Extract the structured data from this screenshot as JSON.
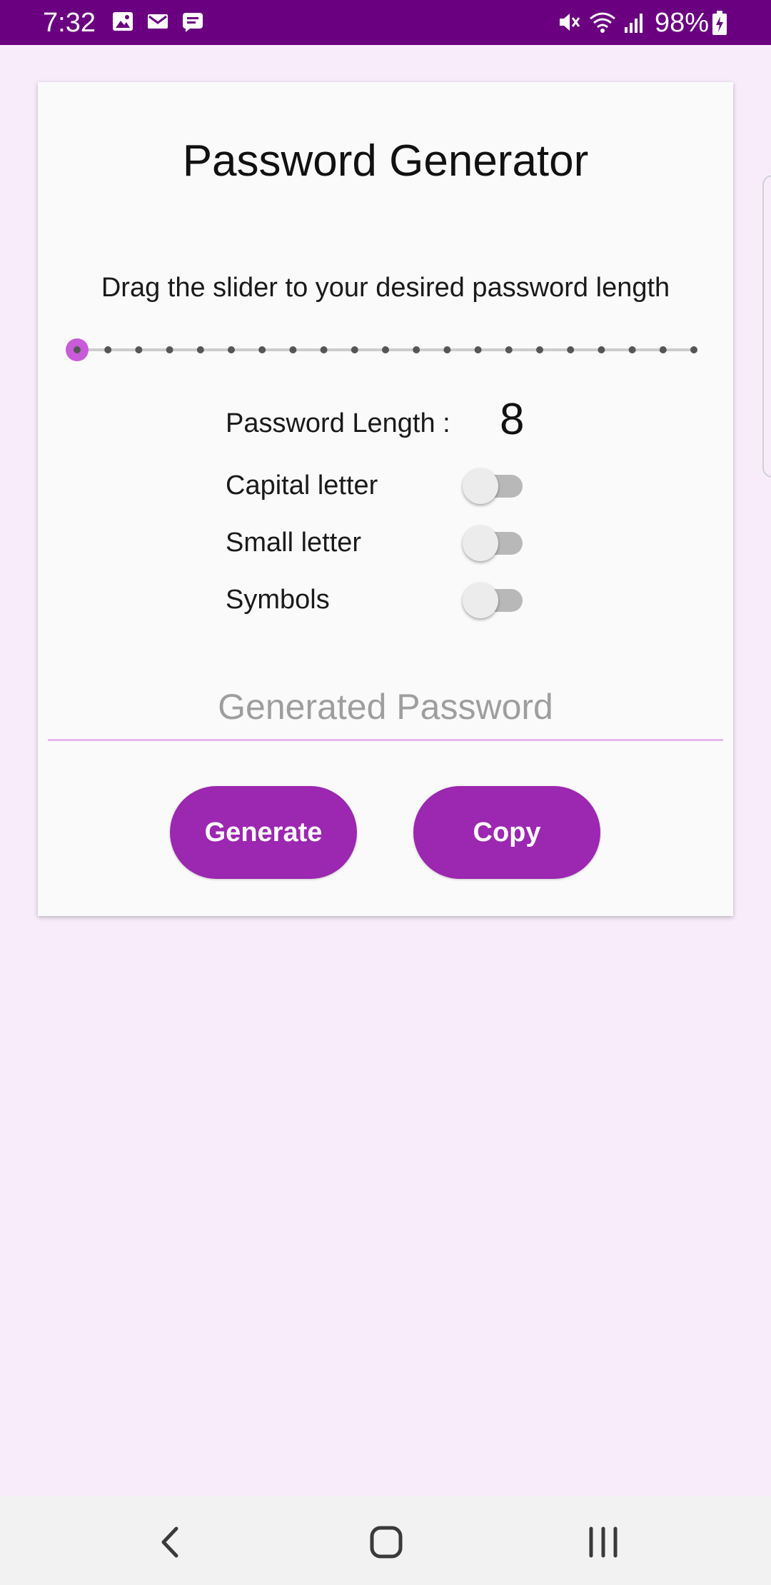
{
  "status_bar": {
    "time": "7:32",
    "battery": "98%",
    "left_icons": [
      "gallery-icon",
      "gmail-icon",
      "message-icon"
    ],
    "right_icons": [
      "mute-icon",
      "wifi-icon",
      "signal-icon",
      "battery-icon"
    ]
  },
  "app": {
    "title": "Password Generator",
    "instruction": "Drag the slider to your desired password length",
    "slider": {
      "steps": 21,
      "selected_index": 0
    },
    "length_label": "Password Length :",
    "length_value": "8",
    "options": [
      {
        "label": "Capital letter",
        "enabled": false
      },
      {
        "label": "Small letter",
        "enabled": false
      },
      {
        "label": "Symbols",
        "enabled": false
      }
    ],
    "password_placeholder": "Generated Password",
    "password_value": "",
    "generate_label": "Generate",
    "copy_label": "Copy"
  },
  "colors": {
    "status_bar": "#6a0080",
    "background": "#f8ecfb",
    "accent": "#9c27b0",
    "slider_thumb": "#c85cd8",
    "field_underline": "#e8b8f0"
  },
  "nav_bar": {
    "icons": [
      "back-icon",
      "home-icon",
      "recents-icon"
    ]
  }
}
